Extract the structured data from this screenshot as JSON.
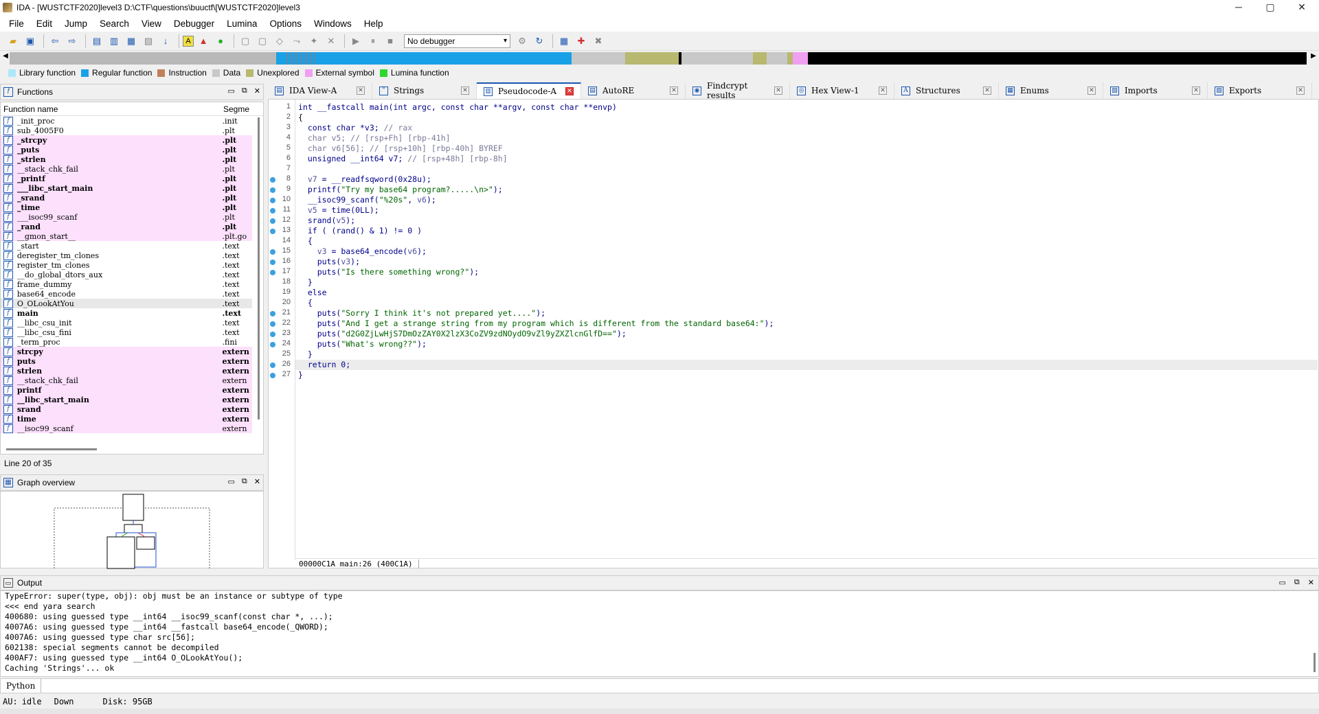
{
  "window": {
    "title": "IDA - [WUSTCTF2020]level3 D:\\CTF\\questions\\buuctf\\[WUSTCTF2020]level3",
    "minimize": "─",
    "maximize": "▢",
    "close": "✕"
  },
  "menu": [
    "File",
    "Edit",
    "Jump",
    "Search",
    "View",
    "Debugger",
    "Lumina",
    "Options",
    "Windows",
    "Help"
  ],
  "toolbar": {
    "debugger_select": "No debugger"
  },
  "legend": [
    {
      "label": "Library function",
      "color": "#aee8f8"
    },
    {
      "label": "Regular function",
      "color": "#1aa0e6"
    },
    {
      "label": "Instruction",
      "color": "#c0805a"
    },
    {
      "label": "Data",
      "color": "#c8c8c8"
    },
    {
      "label": "Unexplored",
      "color": "#b8b870"
    },
    {
      "label": "External symbol",
      "color": "#f0a0f0"
    },
    {
      "label": "Lumina function",
      "color": "#2ed62e"
    }
  ],
  "functions_pane": {
    "title": "Functions",
    "col_name": "Function name",
    "col_segment": "Segme",
    "line_status": "Line 20 of 35",
    "rows": [
      {
        "name": "_init_proc",
        "seg": ".init",
        "style": ""
      },
      {
        "name": "sub_4005F0",
        "seg": ".plt",
        "style": ""
      },
      {
        "name": "_strcpy",
        "seg": ".plt",
        "style": "pk bold"
      },
      {
        "name": "_puts",
        "seg": ".plt",
        "style": "pk bold"
      },
      {
        "name": "_strlen",
        "seg": ".plt",
        "style": "pk bold"
      },
      {
        "name": "__stack_chk_fail",
        "seg": ".plt",
        "style": "pk"
      },
      {
        "name": "_printf",
        "seg": ".plt",
        "style": "pk bold"
      },
      {
        "name": "___libc_start_main",
        "seg": ".plt",
        "style": "pk bold"
      },
      {
        "name": "_srand",
        "seg": ".plt",
        "style": "pk bold"
      },
      {
        "name": "_time",
        "seg": ".plt",
        "style": "pk bold"
      },
      {
        "name": "___isoc99_scanf",
        "seg": ".plt",
        "style": "pk"
      },
      {
        "name": "_rand",
        "seg": ".plt",
        "style": "pk bold"
      },
      {
        "name": "__gmon_start__",
        "seg": ".plt.go",
        "style": "pk"
      },
      {
        "name": "_start",
        "seg": ".text",
        "style": ""
      },
      {
        "name": "deregister_tm_clones",
        "seg": ".text",
        "style": ""
      },
      {
        "name": "register_tm_clones",
        "seg": ".text",
        "style": ""
      },
      {
        "name": "__do_global_dtors_aux",
        "seg": ".text",
        "style": ""
      },
      {
        "name": "frame_dummy",
        "seg": ".text",
        "style": ""
      },
      {
        "name": "base64_encode",
        "seg": ".text",
        "style": ""
      },
      {
        "name": "O_OLookAtYou",
        "seg": ".text",
        "style": "sel"
      },
      {
        "name": "main",
        "seg": ".text",
        "style": "bold"
      },
      {
        "name": "__libc_csu_init",
        "seg": ".text",
        "style": ""
      },
      {
        "name": "__libc_csu_fini",
        "seg": ".text",
        "style": ""
      },
      {
        "name": "_term_proc",
        "seg": ".fini",
        "style": ""
      },
      {
        "name": "strcpy",
        "seg": "extern",
        "style": "pk bold"
      },
      {
        "name": "puts",
        "seg": "extern",
        "style": "pk bold"
      },
      {
        "name": "strlen",
        "seg": "extern",
        "style": "pk bold"
      },
      {
        "name": "__stack_chk_fail",
        "seg": "extern",
        "style": "pk"
      },
      {
        "name": "printf",
        "seg": "extern",
        "style": "pk bold"
      },
      {
        "name": "__libc_start_main",
        "seg": "extern",
        "style": "pk bold"
      },
      {
        "name": "srand",
        "seg": "extern",
        "style": "pk bold"
      },
      {
        "name": "time",
        "seg": "extern",
        "style": "pk bold"
      },
      {
        "name": "__isoc99_scanf",
        "seg": "extern",
        "style": "pk"
      }
    ]
  },
  "graph_pane": {
    "title": "Graph overview"
  },
  "tabs": [
    {
      "label": "IDA View-A",
      "icon": "ida-view-icon"
    },
    {
      "label": "Strings",
      "icon": "strings-icon"
    },
    {
      "label": "Pseudocode-A",
      "icon": "pseudocode-icon",
      "active": true
    },
    {
      "label": "AutoRE",
      "icon": "autore-icon"
    },
    {
      "label": "Findcrypt results",
      "icon": "findcrypt-icon"
    },
    {
      "label": "Hex View-1",
      "icon": "hex-view-icon"
    },
    {
      "label": "Structures",
      "icon": "structures-icon"
    },
    {
      "label": "Enums",
      "icon": "enums-icon"
    },
    {
      "label": "Imports",
      "icon": "imports-icon"
    },
    {
      "label": "Exports",
      "icon": "exports-icon"
    }
  ],
  "code": {
    "lines": [
      {
        "n": "1",
        "dot": false,
        "segs": [
          [
            "kw",
            "int __fastcall main(int argc, const char **argv, const char **envp)"
          ]
        ]
      },
      {
        "n": "2",
        "dot": false,
        "segs": [
          [
            "df",
            "{"
          ]
        ]
      },
      {
        "n": "3",
        "dot": false,
        "segs": [
          [
            "kw",
            "  const char *v3; "
          ],
          [
            "cm",
            "// rax"
          ]
        ]
      },
      {
        "n": "4",
        "dot": false,
        "segs": [
          [
            "cm",
            "  char v5; // [rsp+Fh] [rbp-41h]"
          ]
        ]
      },
      {
        "n": "5",
        "dot": false,
        "segs": [
          [
            "cm",
            "  char v6[56]; // [rsp+10h] [rbp-40h] BYREF"
          ]
        ]
      },
      {
        "n": "6",
        "dot": false,
        "segs": [
          [
            "kw",
            "  unsigned __int64 v7; "
          ],
          [
            "cm",
            "// [rsp+48h] [rbp-8h]"
          ]
        ]
      },
      {
        "n": "7",
        "dot": false,
        "segs": [
          [
            "df",
            ""
          ]
        ]
      },
      {
        "n": "8",
        "dot": true,
        "segs": [
          [
            "vr",
            "  v7"
          ],
          [
            "kw",
            " = __readfsqword(0x28u);"
          ]
        ]
      },
      {
        "n": "9",
        "dot": true,
        "segs": [
          [
            "kw",
            "  printf("
          ],
          [
            "st",
            "\"Try my base64 program?.....\\n>\""
          ],
          [
            "kw",
            ");"
          ]
        ]
      },
      {
        "n": "10",
        "dot": true,
        "segs": [
          [
            "kw",
            "  __isoc99_scanf("
          ],
          [
            "st",
            "\"%20s\""
          ],
          [
            "kw",
            ", "
          ],
          [
            "vr",
            "v6"
          ],
          [
            "kw",
            ");"
          ]
        ]
      },
      {
        "n": "11",
        "dot": true,
        "segs": [
          [
            "vr",
            "  v5"
          ],
          [
            "kw",
            " = time(0LL);"
          ]
        ]
      },
      {
        "n": "12",
        "dot": true,
        "segs": [
          [
            "kw",
            "  srand("
          ],
          [
            "vr",
            "v5"
          ],
          [
            "kw",
            ");"
          ]
        ]
      },
      {
        "n": "13",
        "dot": true,
        "segs": [
          [
            "kw",
            "  if ( (rand() & 1) != 0 )"
          ]
        ]
      },
      {
        "n": "14",
        "dot": false,
        "segs": [
          [
            "kw",
            "  {"
          ]
        ]
      },
      {
        "n": "15",
        "dot": true,
        "segs": [
          [
            "vr",
            "    v3"
          ],
          [
            "kw",
            " = base64_encode("
          ],
          [
            "vr",
            "v6"
          ],
          [
            "kw",
            ");"
          ]
        ]
      },
      {
        "n": "16",
        "dot": true,
        "segs": [
          [
            "kw",
            "    puts("
          ],
          [
            "vr",
            "v3"
          ],
          [
            "kw",
            ");"
          ]
        ]
      },
      {
        "n": "17",
        "dot": true,
        "segs": [
          [
            "kw",
            "    puts("
          ],
          [
            "st",
            "\"Is there something wrong?\""
          ],
          [
            "kw",
            ");"
          ]
        ]
      },
      {
        "n": "18",
        "dot": false,
        "segs": [
          [
            "kw",
            "  }"
          ]
        ]
      },
      {
        "n": "19",
        "dot": false,
        "segs": [
          [
            "kw",
            "  else"
          ]
        ]
      },
      {
        "n": "20",
        "dot": false,
        "segs": [
          [
            "kw",
            "  {"
          ]
        ]
      },
      {
        "n": "21",
        "dot": true,
        "segs": [
          [
            "kw",
            "    puts("
          ],
          [
            "st",
            "\"Sorry I think it's not prepared yet....\""
          ],
          [
            "kw",
            ");"
          ]
        ]
      },
      {
        "n": "22",
        "dot": true,
        "segs": [
          [
            "kw",
            "    puts("
          ],
          [
            "st",
            "\"And I get a strange string from my program which is different from the standard base64:\""
          ],
          [
            "kw",
            ");"
          ]
        ]
      },
      {
        "n": "23",
        "dot": true,
        "segs": [
          [
            "kw",
            "    puts("
          ],
          [
            "st",
            "\"d2G0ZjLwHjS7DmOzZAY0X2lzX3CoZV9zdNOydO9vZl9yZXZlcnGlfD==\""
          ],
          [
            "kw",
            ");"
          ]
        ]
      },
      {
        "n": "24",
        "dot": true,
        "segs": [
          [
            "kw",
            "    puts("
          ],
          [
            "st",
            "\"What's wrong??\""
          ],
          [
            "kw",
            ");"
          ]
        ]
      },
      {
        "n": "25",
        "dot": false,
        "segs": [
          [
            "kw",
            "  }"
          ]
        ]
      },
      {
        "n": "26",
        "dot": true,
        "hl": true,
        "segs": [
          [
            "kw",
            "  return 0;"
          ]
        ]
      },
      {
        "n": "27",
        "dot": true,
        "segs": [
          [
            "kw",
            "}"
          ]
        ]
      }
    ],
    "status": "00000C1A main:26 (400C1A)"
  },
  "output": {
    "title": "Output",
    "lines": [
      "TypeError: super(type, obj): obj must be an instance or subtype of type",
      "<<< end yara search",
      "400680: using guessed type __int64 __isoc99_scanf(const char *, ...);",
      "4007A6: using guessed type __int64 __fastcall base64_encode(_QWORD);",
      "4007A6: using guessed type char src[56];",
      "602138: special segments cannot be decompiled",
      "400AF7: using guessed type __int64 O_OLookAtYou();",
      "Caching 'Strings'... ok"
    ]
  },
  "python_tab": "Python",
  "statusbar": {
    "au": "AU:",
    "state": "idle",
    "dir": "Down",
    "disk": "Disk: 95GB"
  }
}
